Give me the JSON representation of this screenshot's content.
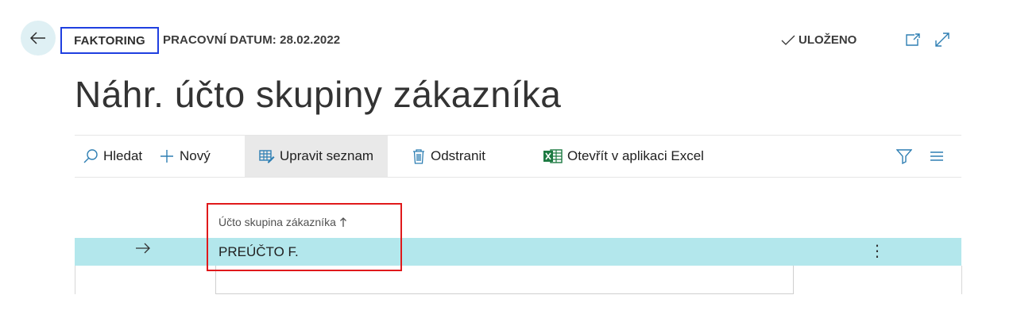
{
  "header": {
    "company": "FAKTORING",
    "working_date": "PRACOVNÍ DATUM: 28.02.2022",
    "saved_status": "ULOŽENO",
    "icons": {
      "back": "arrow-left-icon",
      "saved": "checkmark-icon",
      "open_new_window": "open-in-new-window-icon",
      "expand": "expand-icon"
    }
  },
  "page": {
    "title": "Náhr. účto skupiny zákazníka"
  },
  "actions": {
    "search": "Hledat",
    "new": "Nový",
    "edit_list": "Upravit seznam",
    "delete": "Odstranit",
    "open_excel": "Otevřít v aplikaci Excel",
    "icons": {
      "filter": "filter-icon",
      "list_view": "list-view-icon"
    }
  },
  "grid": {
    "columns": [
      "Účto skupina zákazníka"
    ],
    "sort": "ascending",
    "rows": [
      {
        "value": "PREÚČTO F.",
        "selected": true
      }
    ]
  },
  "colors": {
    "accent_light": "#b3e7ec",
    "back_button_bg": "#dff0f4",
    "company_border": "#1f3fe0",
    "annotation_red": "#e0191b",
    "excel_green": "#1d7a42"
  }
}
